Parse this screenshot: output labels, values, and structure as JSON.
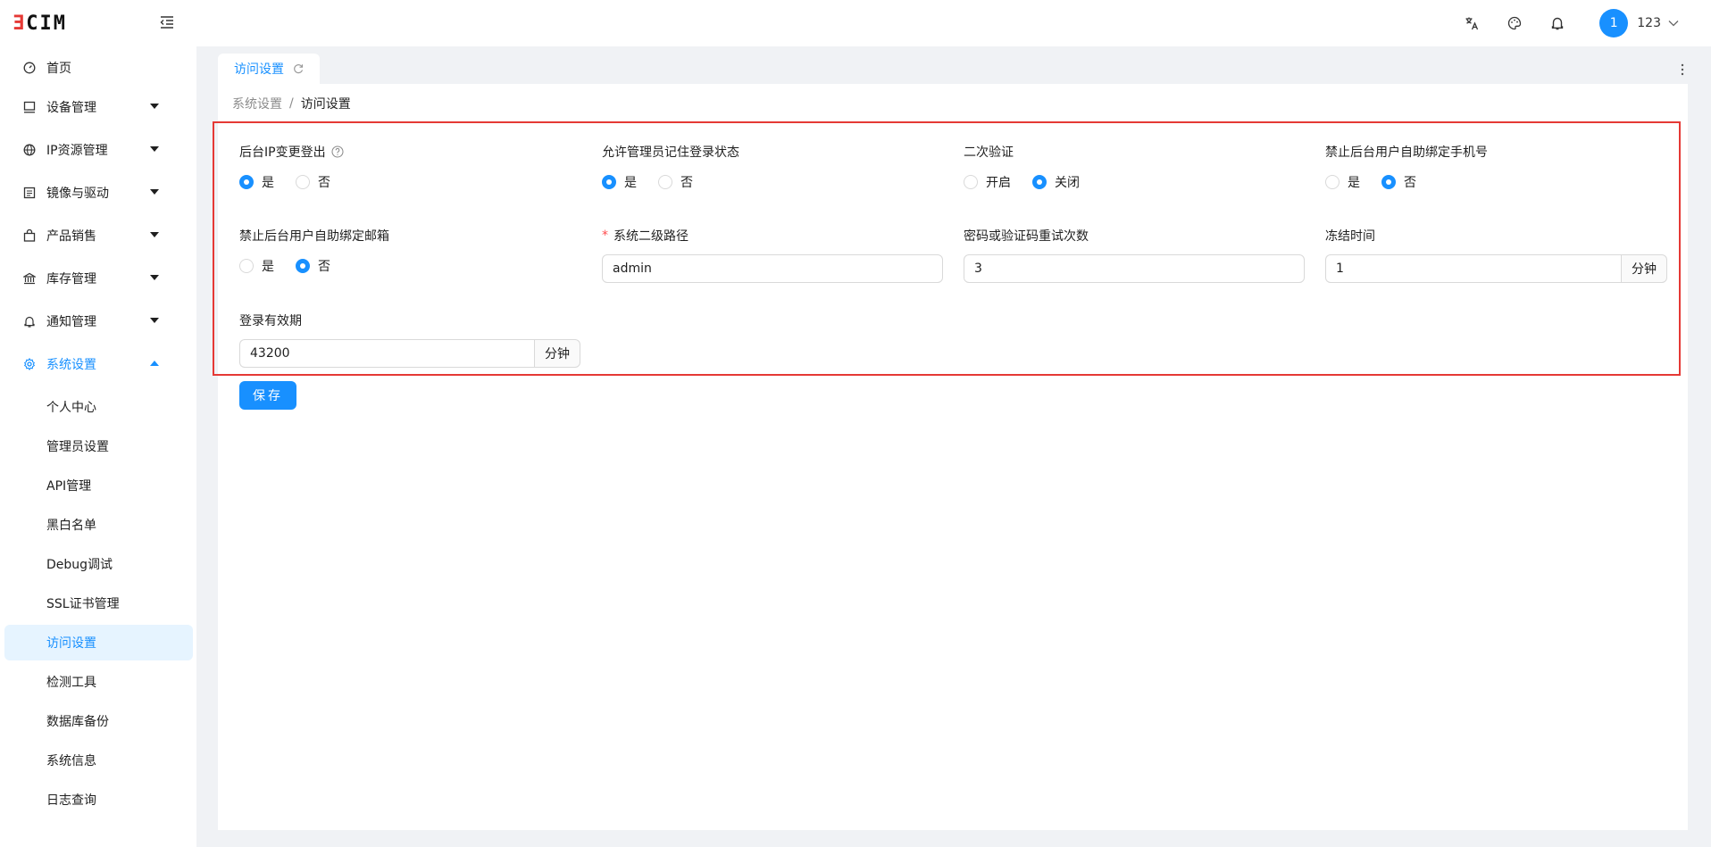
{
  "app": {
    "logo_text": "ƎCIM"
  },
  "header": {
    "avatar_text": "1",
    "username": "123",
    "icons": [
      "translate-icon",
      "theme-icon",
      "bell-icon"
    ]
  },
  "sidebar": {
    "items": [
      {
        "label": "首页",
        "icon": "dashboard-icon"
      },
      {
        "label": "设备管理",
        "icon": "monitor-icon"
      },
      {
        "label": "IP资源管理",
        "icon": "globe-icon"
      },
      {
        "label": "镜像与驱动",
        "icon": "image-icon"
      },
      {
        "label": "产品销售",
        "icon": "bag-icon"
      },
      {
        "label": "库存管理",
        "icon": "bank-icon"
      },
      {
        "label": "通知管理",
        "icon": "bell-icon"
      },
      {
        "label": "系统设置",
        "icon": "gear-icon"
      }
    ],
    "sub_items": [
      {
        "label": "个人中心"
      },
      {
        "label": "管理员设置"
      },
      {
        "label": "API管理"
      },
      {
        "label": "黑白名单"
      },
      {
        "label": "Debug调试"
      },
      {
        "label": "SSL证书管理"
      },
      {
        "label": "访问设置"
      },
      {
        "label": "检测工具"
      },
      {
        "label": "数据库备份"
      },
      {
        "label": "系统信息"
      },
      {
        "label": "日志查询"
      }
    ],
    "selected": "访问设置"
  },
  "tabs": [
    {
      "label": "访问设置"
    }
  ],
  "breadcrumb": {
    "parent": "系统设置",
    "separator": "/",
    "current": "访问设置"
  },
  "form": {
    "ip_change_logout": {
      "label": "后台IP变更登出",
      "options": [
        "是",
        "否"
      ],
      "selected": "是"
    },
    "remember_login": {
      "label": "允许管理员记住登录状态",
      "options": [
        "是",
        "否"
      ],
      "selected": "是"
    },
    "two_factor": {
      "label": "二次验证",
      "options": [
        "开启",
        "关闭"
      ],
      "selected": "关闭"
    },
    "forbid_bind_phone": {
      "label": "禁止后台用户自助绑定手机号",
      "options": [
        "是",
        "否"
      ],
      "selected": "否"
    },
    "forbid_bind_email": {
      "label": "禁止后台用户自助绑定邮箱",
      "options": [
        "是",
        "否"
      ],
      "selected": "否"
    },
    "secondary_path": {
      "label": "系统二级路径",
      "required_mark": "*",
      "value": "admin"
    },
    "retry_count": {
      "label": "密码或验证码重试次数",
      "value": "3"
    },
    "freeze_time": {
      "label": "冻结时间",
      "value": "1",
      "unit": "分钟"
    },
    "login_validity": {
      "label": "登录有效期",
      "value": "43200",
      "unit": "分钟"
    }
  },
  "save_button": {
    "label": "保存"
  },
  "colors": {
    "primary": "#1890ff",
    "highlight_border": "#e53935",
    "logo_mark": "#e53935"
  }
}
